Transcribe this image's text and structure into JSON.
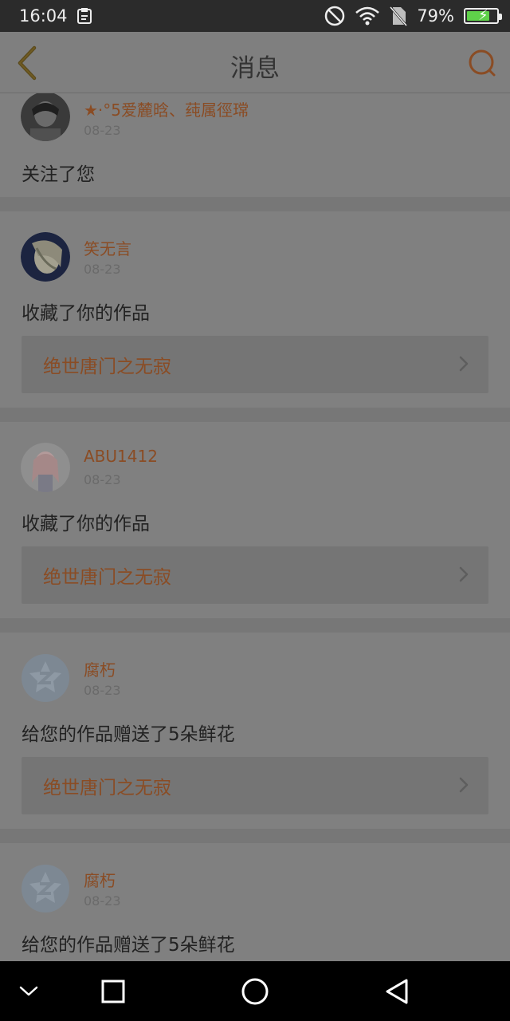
{
  "status_bar": {
    "time": "16:04",
    "battery_percent": "79%",
    "battery_level": 0.79,
    "icons": [
      "clipboard-icon",
      "do-not-disturb-icon",
      "wifi-icon",
      "no-sim-icon",
      "battery-charging-icon"
    ]
  },
  "header": {
    "title": "消息",
    "back_icon": "chevron-left-icon",
    "search_icon": "search-icon"
  },
  "messages": [
    {
      "username": "★·°5爱麓晗、莼属徑瑺",
      "time": "08-23",
      "action": "关注了您",
      "work_title": null
    },
    {
      "username": "笑无言",
      "time": "08-23",
      "action": "收藏了你的作品",
      "work_title": "绝世唐门之无寂"
    },
    {
      "username": "ABU1412",
      "time": "08-23",
      "action": "收藏了你的作品",
      "work_title": "绝世唐门之无寂"
    },
    {
      "username": "腐朽",
      "time": "08-23",
      "action": "给您的作品赠送了5朵鲜花",
      "work_title": "绝世唐门之无寂"
    },
    {
      "username": "腐朽",
      "time": "08-23",
      "action": "给您的作品赠送了5朵鲜花",
      "work_title": null
    }
  ],
  "colors": {
    "accent": "#d9772e",
    "overlay_background": "#7c7c7c"
  },
  "nav_bar": {
    "icons": [
      "collapse-icon",
      "recents-icon",
      "home-icon",
      "back-icon"
    ]
  }
}
